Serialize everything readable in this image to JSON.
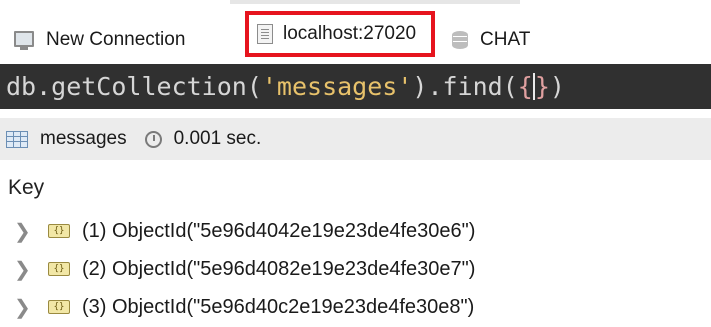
{
  "connection_bar": {
    "new_connection_label": "New Connection",
    "host_label": "localhost:27020",
    "database_label": "CHAT"
  },
  "query": {
    "prefix": "db.getCollection(",
    "collection_string": "'messages'",
    "method": ").find(",
    "brace_open": "{",
    "brace_close": "}",
    "suffix": ")"
  },
  "result_bar": {
    "collection_label": "messages",
    "time_label": "0.001 sec."
  },
  "table": {
    "column_header": "Key",
    "rows": [
      {
        "label": "(1) ObjectId(\"5e96d4042e19e23de4fe30e6\")"
      },
      {
        "label": "(2) ObjectId(\"5e96d4082e19e23de4fe30e7\")"
      },
      {
        "label": "(3) ObjectId(\"5e96d40c2e19e23de4fe30e8\")"
      }
    ]
  },
  "colors": {
    "highlight_box": "#e6141e",
    "query_background": "#303030",
    "result_bar_background": "#ececec"
  },
  "icons": {
    "new_connection": "monitor-icon",
    "host": "server-document-icon",
    "database": "database-icon",
    "collection": "table-grid-icon",
    "time": "clock-icon",
    "expand": "chevron-right-icon",
    "object": "object-id-icon"
  }
}
